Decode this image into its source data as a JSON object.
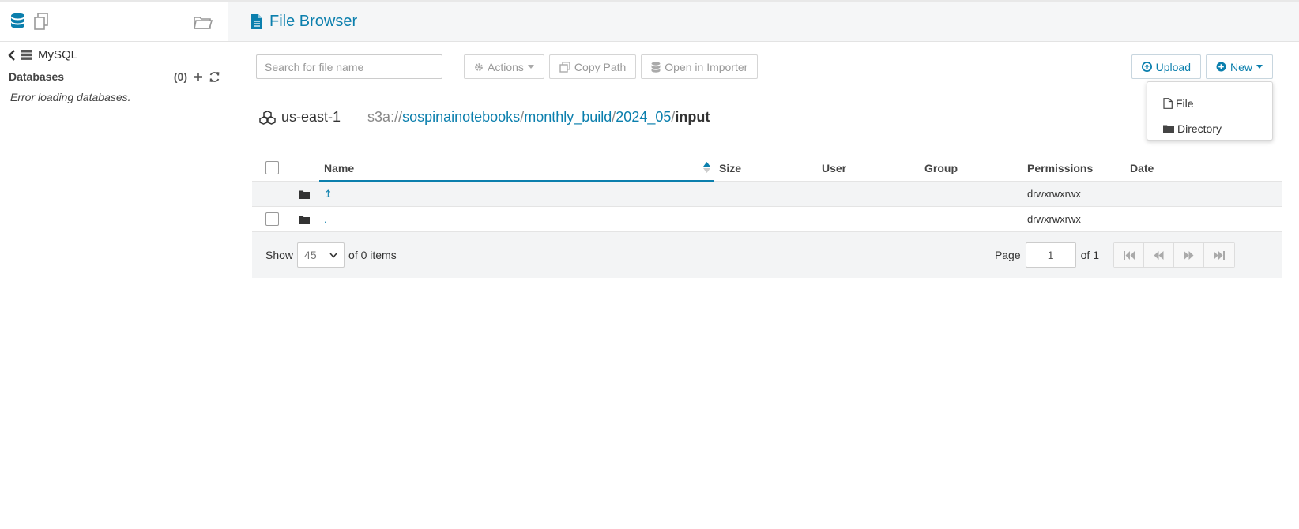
{
  "sidebar": {
    "connection": "MySQL",
    "databases_label": "Databases",
    "databases_count": "(0)",
    "error_text": "Error loading databases."
  },
  "header": {
    "title": "File Browser"
  },
  "toolbar": {
    "search_placeholder": "Search for file name",
    "actions_label": "Actions",
    "copy_path_label": "Copy Path",
    "open_importer_label": "Open in Importer",
    "upload_label": "Upload",
    "new_label": "New"
  },
  "new_menu": {
    "items": [
      "File",
      "Directory"
    ]
  },
  "path": {
    "region": "us-east-1",
    "scheme": "s3a://",
    "segments": [
      "sospinainotebooks",
      "monthly_build",
      "2024_05"
    ],
    "current": "input"
  },
  "table": {
    "columns": [
      "Name",
      "Size",
      "User",
      "Group",
      "Permissions",
      "Date"
    ],
    "rows": [
      {
        "name": "↥",
        "size": "",
        "user": "",
        "group": "",
        "permissions": "drwxrwxrwx",
        "date": ""
      },
      {
        "name": ".",
        "size": "",
        "user": "",
        "group": "",
        "permissions": "drwxrwxrwx",
        "date": ""
      }
    ]
  },
  "pager": {
    "show_label": "Show",
    "page_size": "45",
    "of_items": "of 0 items",
    "page_label": "Page",
    "page_value": "1",
    "of_pages": "of 1"
  },
  "colors": {
    "accent": "#0b7fad",
    "header_bg": "#f5f6f7",
    "row_alt": "#f3f4f5"
  }
}
